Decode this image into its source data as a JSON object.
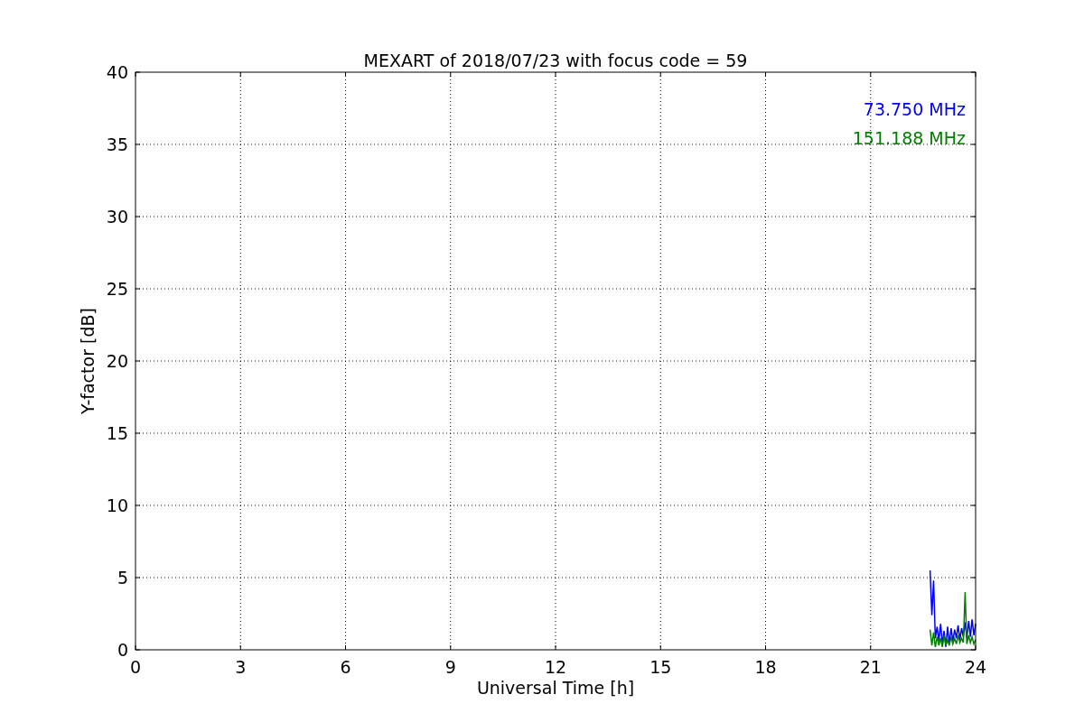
{
  "figure": {
    "chart_data": {
      "type": "line",
      "title": "MEXART of 2018/07/23 with focus code = 59",
      "xlabel": "Universal Time [h]",
      "ylabel": "Y-factor [dB]",
      "x": [
        22.7,
        22.75,
        22.8,
        22.85,
        22.9,
        22.95,
        23.0,
        23.05,
        23.1,
        23.15,
        23.2,
        23.25,
        23.3,
        23.35,
        23.4,
        23.45,
        23.5,
        23.55,
        23.6,
        23.65,
        23.7,
        23.75,
        23.8,
        23.85,
        23.9,
        23.95,
        24.0
      ],
      "series": [
        {
          "name": "73.750 MHz",
          "color": "#0000ff",
          "values": [
            5.5,
            2.4,
            4.8,
            0.8,
            1.6,
            0.6,
            1.8,
            0.4,
            1.3,
            0.2,
            1.6,
            0.4,
            1.5,
            0.6,
            1.4,
            0.8,
            1.7,
            0.7,
            1.5,
            0.9,
            1.9,
            0.8,
            2.0,
            0.9,
            2.1,
            1.0,
            1.8
          ]
        },
        {
          "name": "151.188 MHz",
          "color": "#008000",
          "values": [
            1.4,
            0.3,
            1.2,
            0.2,
            0.9,
            0.3,
            0.8,
            0.2,
            1.0,
            0.3,
            0.7,
            0.3,
            0.9,
            0.4,
            0.8,
            0.4,
            1.0,
            0.5,
            0.8,
            0.5,
            4.0,
            0.4,
            1.0,
            0.5,
            0.9,
            0.4,
            0.7
          ]
        }
      ],
      "xlim": [
        0,
        24
      ],
      "ylim": [
        0,
        40
      ],
      "xticks": [
        0,
        3,
        6,
        9,
        12,
        15,
        18,
        21,
        24
      ],
      "yticks": [
        0,
        5,
        10,
        15,
        20,
        25,
        30,
        35,
        40
      ],
      "grid": true
    }
  }
}
